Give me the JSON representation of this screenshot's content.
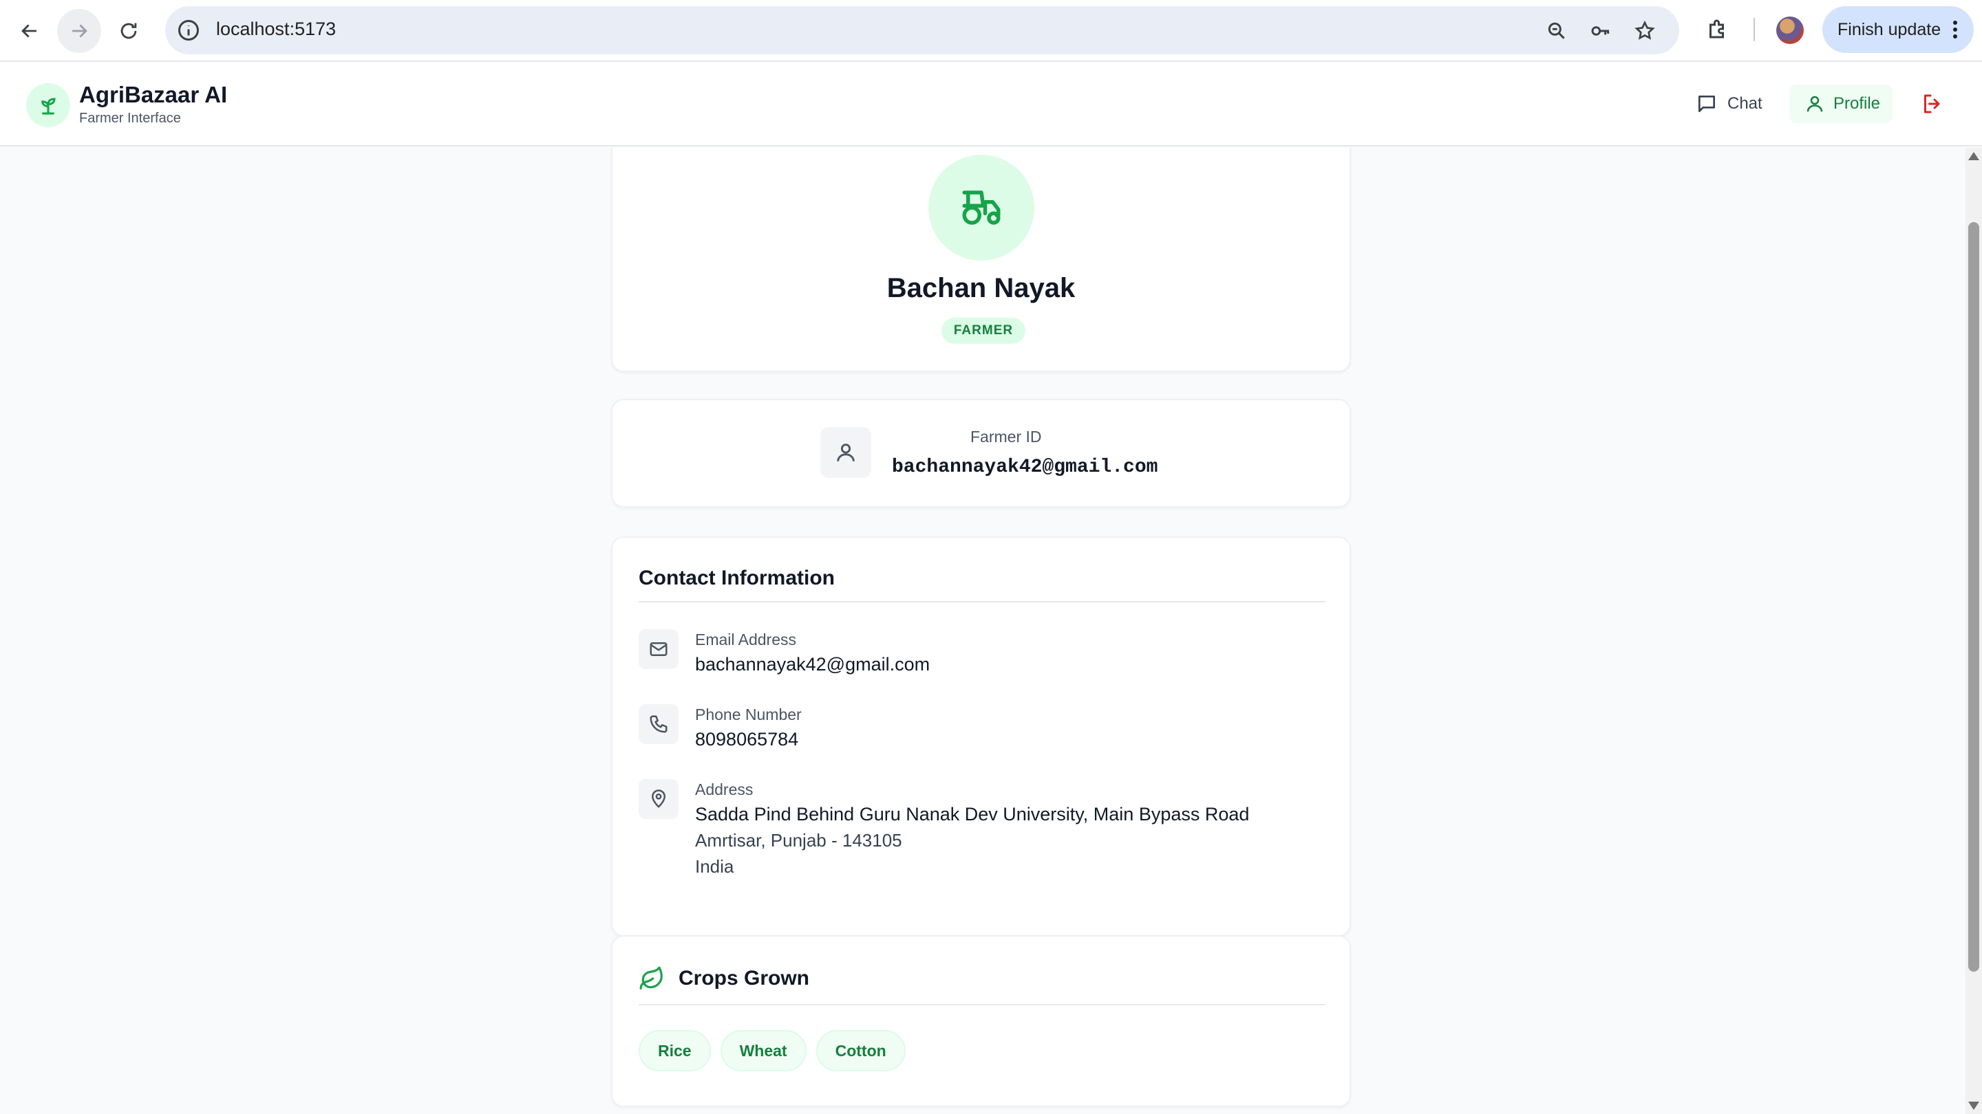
{
  "browser": {
    "url": "localhost:5173",
    "finish_update_label": "Finish update"
  },
  "header": {
    "brand_title": "AgriBazaar AI",
    "brand_subtitle": "Farmer Interface",
    "chat_label": "Chat",
    "profile_label": "Profile"
  },
  "profile": {
    "name": "Bachan Nayak",
    "role_badge": "FARMER",
    "id_label": "Farmer ID",
    "id_value": "bachannayak42@gmail.com"
  },
  "contact": {
    "title": "Contact Information",
    "email_label": "Email Address",
    "email_value": "bachannayak42@gmail.com",
    "phone_label": "Phone Number",
    "phone_value": "8098065784",
    "address_label": "Address",
    "address_line1": "Sadda Pind Behind Guru Nanak Dev University, Main Bypass Road",
    "address_line2": "Amrtisar, Punjab - 143105",
    "address_line3": "India"
  },
  "crops": {
    "title": "Crops Grown",
    "items": [
      "Rice",
      "Wheat",
      "Cotton"
    ]
  },
  "colors": {
    "accent_green": "#15803d",
    "accent_green_light": "#dcfce7",
    "logout_red": "#dc2626",
    "page_bg": "#f8fafc"
  },
  "icons": {
    "logo": "sprout-icon",
    "hero": "tractor-icon",
    "id": "user-icon",
    "email": "mail-icon",
    "phone": "phone-icon",
    "address": "map-pin-icon",
    "crops": "leaf-icon"
  }
}
